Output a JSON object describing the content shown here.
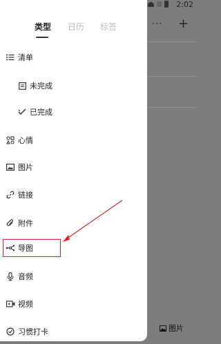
{
  "status": {
    "time": "2:02"
  },
  "background": {
    "more": "···",
    "plus": "+",
    "image_button": "图片"
  },
  "tabs": [
    {
      "label": "类型",
      "active": true
    },
    {
      "label": "日历",
      "active": false
    },
    {
      "label": "标签",
      "active": false
    }
  ],
  "menu": [
    {
      "label": "清单",
      "icon": "list-icon"
    },
    {
      "label": "未完成",
      "icon": "unfinished-icon"
    },
    {
      "label": "已完成",
      "icon": "check-icon"
    },
    {
      "label": "心情",
      "icon": "mood-icon"
    },
    {
      "label": "图片",
      "icon": "image-icon"
    },
    {
      "label": "链接",
      "icon": "link-icon"
    },
    {
      "label": "附件",
      "icon": "attachment-icon"
    },
    {
      "label": "导图",
      "icon": "mindmap-icon"
    },
    {
      "label": "音频",
      "icon": "microphone-icon"
    },
    {
      "label": "视频",
      "icon": "video-icon"
    },
    {
      "label": "习惯打卡",
      "icon": "habit-icon"
    }
  ],
  "colors": {
    "highlight": "#dd2222",
    "active_tab": "#222222",
    "inactive_tab": "#bbbbbb",
    "overlay": "#7d7d7d"
  }
}
